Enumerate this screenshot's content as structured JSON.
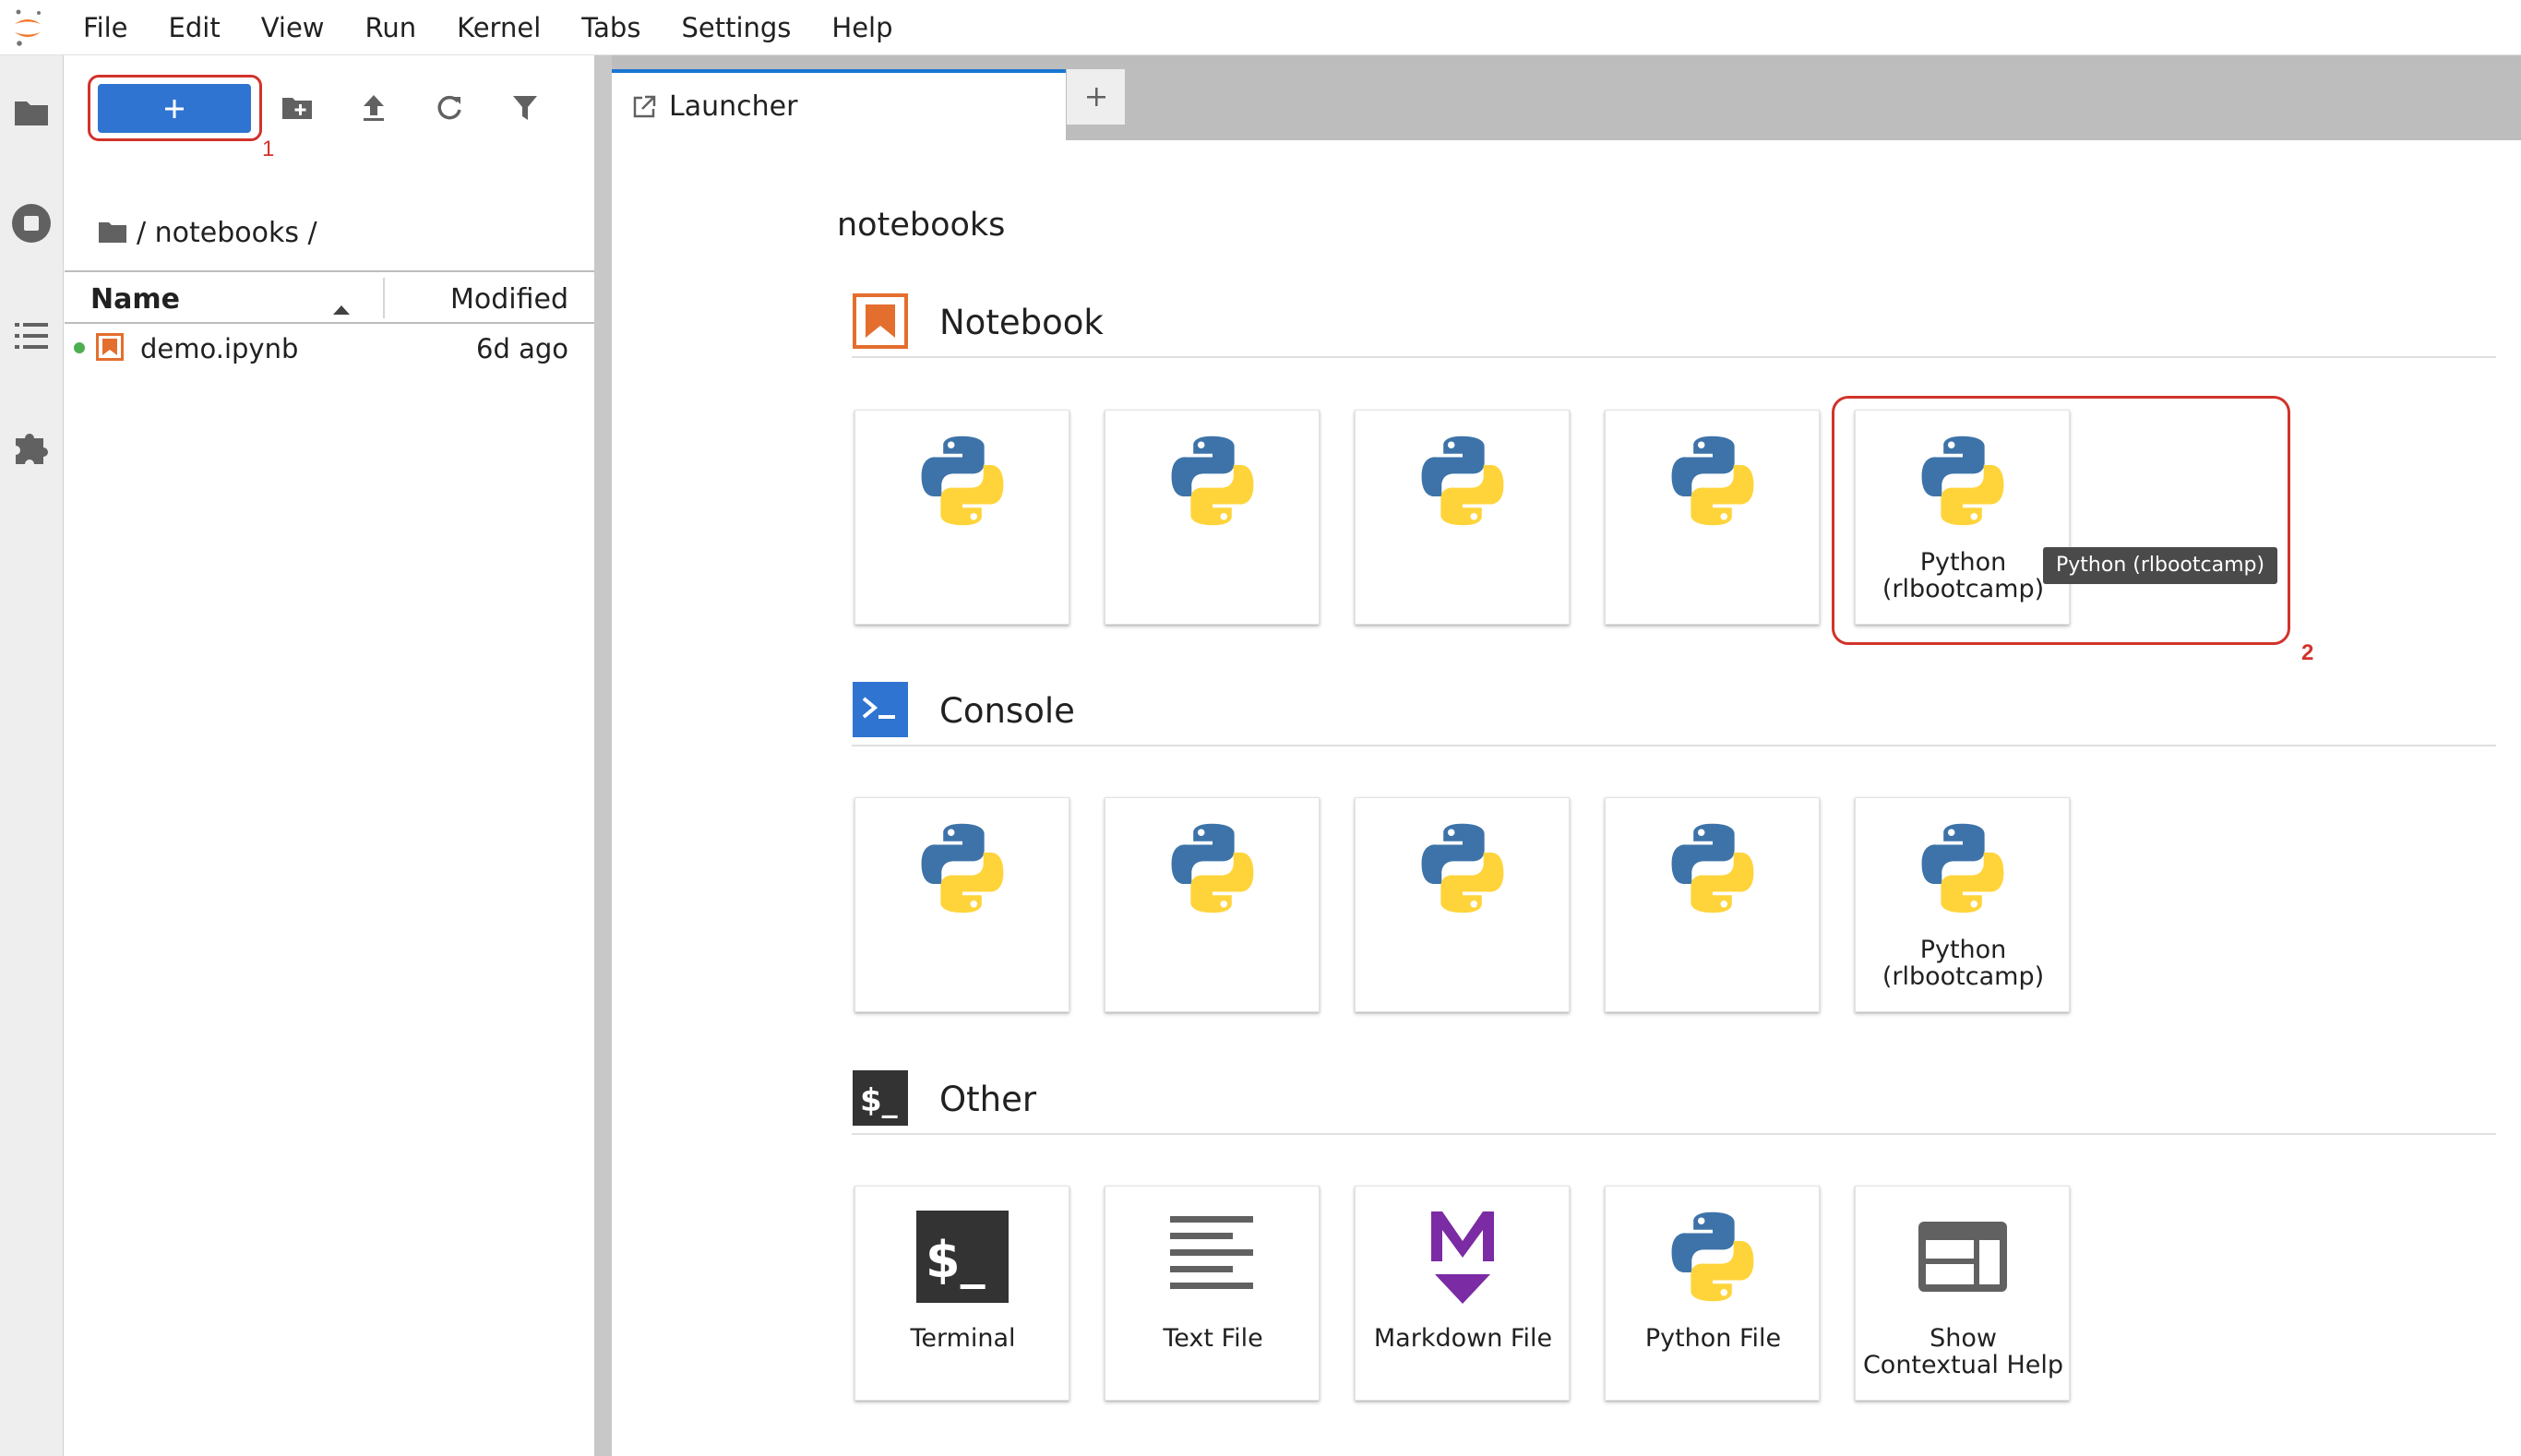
{
  "menubar": {
    "items": [
      "File",
      "Edit",
      "View",
      "Run",
      "Kernel",
      "Tabs",
      "Settings",
      "Help"
    ]
  },
  "activity_bar": {
    "icons": [
      "folder-icon",
      "running-stop-icon",
      "table-of-contents-icon",
      "extension-puzzle-icon"
    ]
  },
  "file_browser": {
    "new_launcher_label": "+",
    "toolbar_icons": [
      "new-folder-icon",
      "upload-icon",
      "refresh-icon",
      "filter-icon"
    ],
    "breadcrumb": "/ notebooks /",
    "columns": {
      "name": "Name",
      "modified": "Modified"
    },
    "files": [
      {
        "name": "demo.ipynb",
        "modified": "6d ago",
        "running": true
      }
    ]
  },
  "annotations": {
    "label_1": "1",
    "label_2": "2"
  },
  "tabs": {
    "launcher_label": "Launcher",
    "add_label": "+"
  },
  "launcher": {
    "cwd": "notebooks",
    "notebook": {
      "title": "Notebook",
      "cards": [
        "",
        "",
        "",
        "",
        "Python\n(rlbootcamp)"
      ]
    },
    "console": {
      "title": "Console",
      "cards": [
        "",
        "",
        "",
        "",
        "Python\n(rlbootcamp)"
      ]
    },
    "other": {
      "title": "Other",
      "cards": [
        "Terminal",
        "Text File",
        "Markdown File",
        "Python File",
        "Show\nContextual Help"
      ]
    },
    "tooltip": "Python (rlbootcamp)"
  },
  "colors": {
    "accent": "#2f74d0",
    "annotation": "#d1332b",
    "notebook_icon": "#e46e2e",
    "markdown": "#7b2ba3"
  }
}
